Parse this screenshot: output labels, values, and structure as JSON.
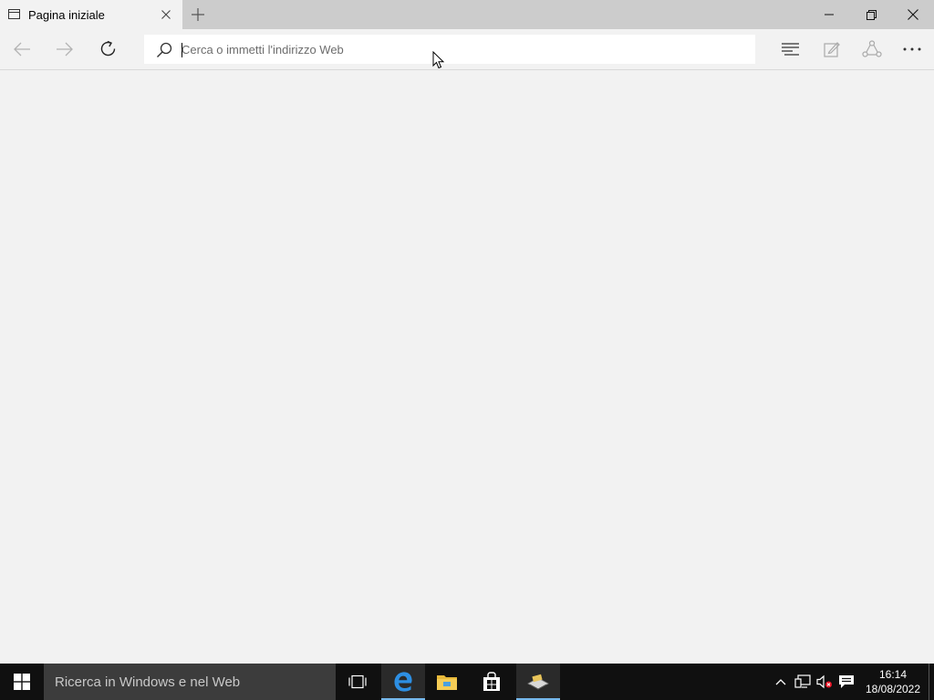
{
  "tab": {
    "title": "Pagina iniziale",
    "page_icon": "page-icon",
    "close_icon": "close-icon",
    "new_tab_icon": "plus-icon"
  },
  "window_controls": [
    "minimize-icon",
    "restore-icon",
    "close-icon"
  ],
  "toolbar": {
    "back_icon": "arrow-left-icon",
    "forward_icon": "arrow-right-icon",
    "refresh_icon": "refresh-icon",
    "address_placeholder": "Cerca o immetti l'indirizzo Web",
    "address_value": "",
    "hub_icon": "hub-icon",
    "note_icon": "web-note-icon",
    "share_icon": "share-icon",
    "more_icon": "more-icon"
  },
  "taskbar": {
    "search_placeholder": "Ricerca in Windows e nel Web",
    "apps": [
      "task-view-icon",
      "edge-icon",
      "file-explorer-icon",
      "store-icon",
      "app-icon"
    ],
    "active_app": "edge-icon",
    "tray": [
      "chevron-up-icon",
      "network-icon",
      "volume-muted-icon",
      "notifications-icon"
    ],
    "time": "16:14",
    "date": "18/08/2022"
  },
  "colors": {
    "titlebar": "#cccccc",
    "chrome": "#f2f2f2",
    "taskbar": "#101010",
    "taskbar_search": "#3c3c3c",
    "accent": "#76b9ed"
  }
}
